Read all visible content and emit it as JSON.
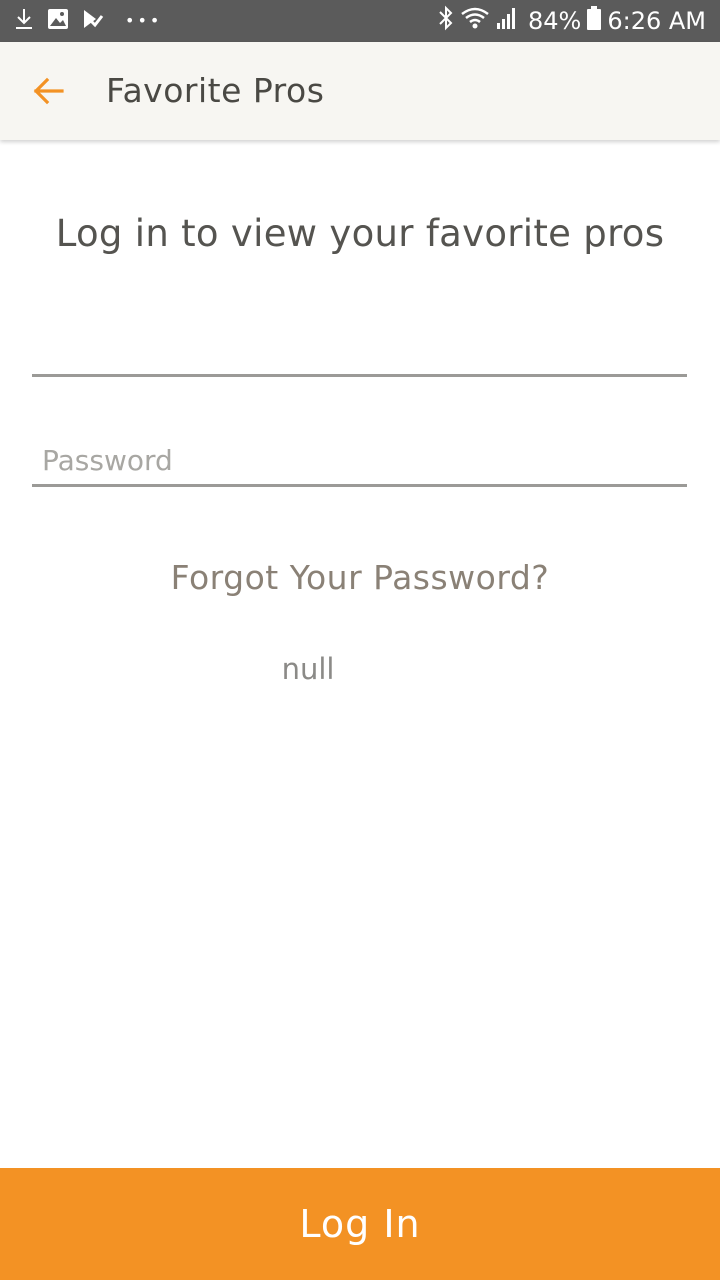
{
  "status_bar": {
    "battery_percent": "84%",
    "time": "6:26 AM",
    "left_icons": [
      "download-icon",
      "image-icon",
      "checklist-icon"
    ],
    "right_icons": [
      "bluetooth-icon",
      "wifi-icon",
      "signal-icon",
      "battery-icon"
    ],
    "dots": "•••"
  },
  "app_bar": {
    "title": "Favorite Pros",
    "back_icon": "arrow-left-icon",
    "accent_color": "#F39224"
  },
  "main": {
    "heading": "Log in to view your favorite pros",
    "username": {
      "value": "",
      "placeholder": ""
    },
    "password": {
      "value": "",
      "placeholder": "Password"
    },
    "forgot_password_label": "Forgot Your Password?",
    "null_text": "null"
  },
  "footer": {
    "login_label": "Log In",
    "button_color": "#F39224"
  }
}
